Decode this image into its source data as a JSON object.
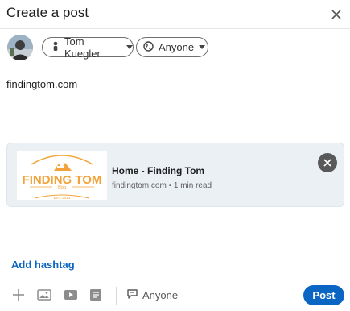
{
  "header": {
    "title": "Create a post",
    "close_icon": "close-icon"
  },
  "author": {
    "name": "Tom Kuegler",
    "avatar": "avatar",
    "visibility": "Anyone",
    "icons": {
      "person": "person-icon",
      "globe": "globe-icon",
      "caret": "caret-down-icon"
    }
  },
  "post": {
    "text": "findingtom.com"
  },
  "link_preview": {
    "title": "Home - Finding Tom",
    "meta": "findingtom.com • 1 min read",
    "thumbnail": {
      "logo_text": "FINDING TOM",
      "tagline": "Blog",
      "est": "EST. 2013"
    },
    "close_icon": "close-icon"
  },
  "hashtag": {
    "label": "Add hashtag"
  },
  "toolbar": {
    "icons": [
      "plus-icon",
      "image-icon",
      "video-icon",
      "document-icon"
    ],
    "comment_visibility": "Anyone",
    "comment_icon": "comment-icon",
    "post_label": "Post"
  },
  "colors": {
    "accent": "#0a66c2",
    "card_bg": "#ebf0f5",
    "logo_orange": "#f2a33a"
  }
}
